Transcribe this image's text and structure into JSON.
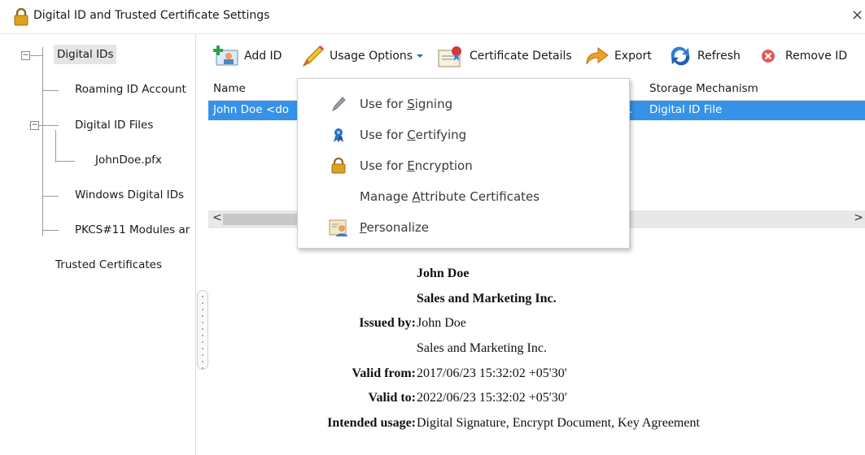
{
  "window": {
    "title": "Digital ID and Trusted Certificate Settings",
    "close_glyph": "×",
    "lock_icon": "lock-icon"
  },
  "tree": {
    "root": "Digital IDs",
    "children": [
      "Roaming ID Account",
      "Digital ID Files",
      "JohnDoe.pfx",
      "Windows Digital IDs",
      "PKCS#11 Modules ar"
    ],
    "trusted": "Trusted Certificates",
    "expanded_glyph": "−"
  },
  "toolbar": {
    "add_id": "Add ID",
    "usage_options": "Usage Options",
    "certificate_details": "Certificate Details",
    "export": "Export",
    "refresh": "Refresh",
    "remove_id": "Remove ID",
    "highlight_color": "#f0a030"
  },
  "list": {
    "columns": [
      "Name",
      "Storage Mechanism"
    ],
    "rows": [
      {
        "name": "John Doe <do",
        "issuer_tail": ".",
        "storage": "Digital ID File"
      }
    ],
    "selection_color": "#3592e8"
  },
  "menu": {
    "items": [
      {
        "pre": "Use for ",
        "accel": "S",
        "post": "igning",
        "icon": "pen-icon"
      },
      {
        "pre": "Use for ",
        "accel": "C",
        "post": "ertifying",
        "icon": "ribbon-icon"
      },
      {
        "pre": "Use for ",
        "accel": "E",
        "post": "ncryption",
        "icon": "lock-icon"
      },
      {
        "pre": "Manage ",
        "accel": "A",
        "post": "ttribute Certificates",
        "icon": ""
      },
      {
        "pre": "",
        "accel": "P",
        "post": "ersonalize",
        "icon": "personalize-icon"
      }
    ]
  },
  "details": {
    "name": "John Doe",
    "org": "Sales and Marketing Inc.",
    "issued_by_label": "Issued by:",
    "issued_by_name": "John Doe",
    "issued_by_org": "Sales and Marketing Inc.",
    "valid_from_label": "Valid from:",
    "valid_from": "2017/06/23 15:32:02 +05'30'",
    "valid_to_label": "Valid to:",
    "valid_to": "2022/06/23 15:32:02 +05'30'",
    "intended_usage_label": "Intended usage:",
    "intended_usage": "Digital Signature, Encrypt Document, Key Agreement"
  },
  "scrollbar": {
    "left_arrow": "<",
    "right_arrow": ">"
  }
}
